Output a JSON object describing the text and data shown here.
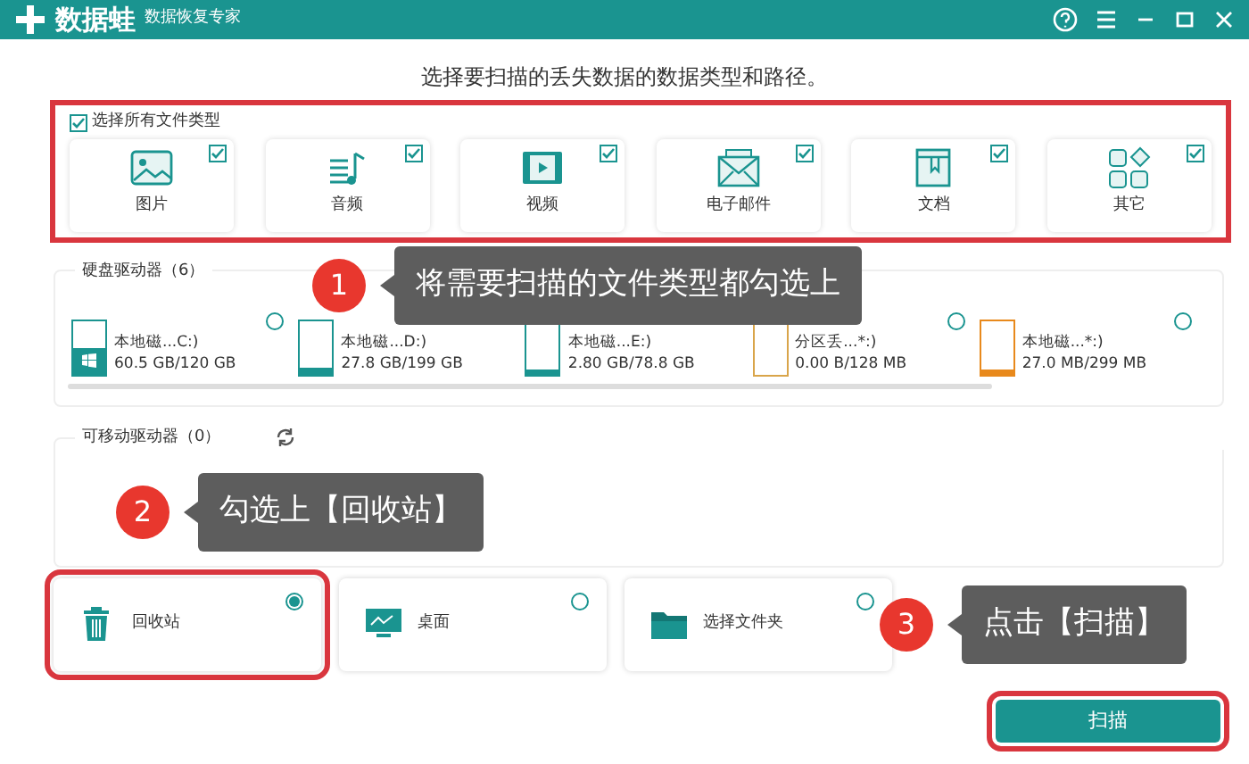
{
  "window": {
    "logo": "数据蛙",
    "subtitle": "数据恢复专家"
  },
  "heading": "选择要扫描的丢失数据的数据类型和路径。",
  "file_types": {
    "select_all": {
      "label": "选择所有文件类型",
      "checked": true
    },
    "items": [
      {
        "label": "图片",
        "kind": "image",
        "checked": true
      },
      {
        "label": "音频",
        "kind": "audio",
        "checked": true
      },
      {
        "label": "视频",
        "kind": "video",
        "checked": true
      },
      {
        "label": "电子邮件",
        "kind": "email",
        "checked": true
      },
      {
        "label": "文档",
        "kind": "document",
        "checked": true
      },
      {
        "label": "其它",
        "kind": "other",
        "checked": true
      }
    ]
  },
  "drives": {
    "title": "硬盘驱动器（6）",
    "items": [
      {
        "name": "本地磁...C:)",
        "usage": "60.5 GB/120 GB",
        "level": 0.5,
        "color": "#1a9490",
        "system": true,
        "selected": false
      },
      {
        "name": "本地磁...D:)",
        "usage": "27.8 GB/199 GB",
        "level": 0.14,
        "color": "#1a9490",
        "system": false
      },
      {
        "name": "本地磁...E:)",
        "usage": "2.80 GB/78.8 GB",
        "level": 0.04,
        "color": "#1a9490",
        "system": false
      },
      {
        "name": "分区丢...*:)",
        "usage": "0.00  B/128 MB",
        "level": 0,
        "color": "#d9a54a",
        "system": false,
        "selected": false
      },
      {
        "name": "本地磁...*:)",
        "usage": "27.0 MB/299 MB",
        "level": 0.1,
        "color": "#e8891c",
        "system": false,
        "selected": false
      }
    ]
  },
  "removable": {
    "title": "可移动驱动器（0）"
  },
  "locations": [
    {
      "label": "回收站",
      "kind": "recycle",
      "selected": true
    },
    {
      "label": "桌面",
      "kind": "desktop",
      "selected": false
    },
    {
      "label": "选择文件夹",
      "kind": "folder",
      "selected": false
    }
  ],
  "scan_button": "扫描",
  "callouts": [
    {
      "number": "1",
      "text": "将需要扫描的文件类型都勾选上"
    },
    {
      "number": "2",
      "text": "勾选上【回收站】"
    },
    {
      "number": "3",
      "text": "点击【扫描】"
    }
  ]
}
